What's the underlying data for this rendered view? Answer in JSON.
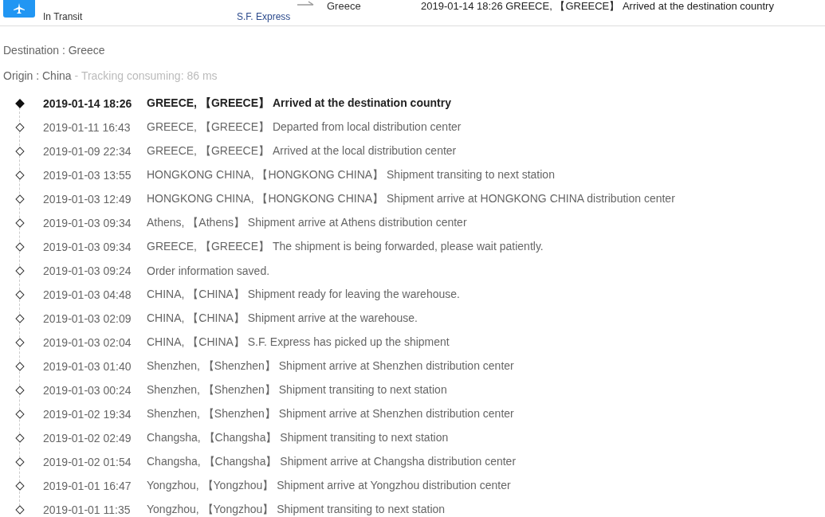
{
  "header": {
    "status": "In Transit",
    "carrier": "S.F. Express",
    "destination": "Greece",
    "latest_event": "2019-01-14 18:26  GREECE, 【GREECE】 Arrived at the destination country"
  },
  "destination": "Destination : Greece",
  "origin": "Origin : China",
  "tracking_time": "- Tracking consuming: 86 ms",
  "events": [
    {
      "time": "2019-01-14 18:26",
      "text": "GREECE, 【GREECE】 Arrived at the destination country",
      "current": true
    },
    {
      "time": "2019-01-11 16:43",
      "text": "GREECE, 【GREECE】 Departed from local distribution center",
      "current": false
    },
    {
      "time": "2019-01-09 22:34",
      "text": "GREECE, 【GREECE】 Arrived at the local distribution center",
      "current": false
    },
    {
      "time": "2019-01-03 13:55",
      "text": "HONGKONG CHINA, 【HONGKONG CHINA】 Shipment transiting to next station",
      "current": false
    },
    {
      "time": "2019-01-03 12:49",
      "text": "HONGKONG CHINA, 【HONGKONG CHINA】 Shipment arrive at HONGKONG CHINA distribution center",
      "current": false
    },
    {
      "time": "2019-01-03 09:34",
      "text": "Athens, 【Athens】 Shipment arrive at Athens distribution center",
      "current": false
    },
    {
      "time": "2019-01-03 09:34",
      "text": "GREECE, 【GREECE】 The shipment is being forwarded, please wait patiently.",
      "current": false
    },
    {
      "time": "2019-01-03 09:24",
      "text": "Order information saved.",
      "current": false
    },
    {
      "time": "2019-01-03 04:48",
      "text": "CHINA, 【CHINA】 Shipment ready for leaving the warehouse.",
      "current": false
    },
    {
      "time": "2019-01-03 02:09",
      "text": "CHINA, 【CHINA】 Shipment arrive at the warehouse.",
      "current": false
    },
    {
      "time": "2019-01-03 02:04",
      "text": "CHINA, 【CHINA】 S.F. Express has picked up the shipment",
      "current": false
    },
    {
      "time": "2019-01-03 01:40",
      "text": "Shenzhen, 【Shenzhen】 Shipment arrive at Shenzhen distribution center",
      "current": false
    },
    {
      "time": "2019-01-03 00:24",
      "text": "Shenzhen, 【Shenzhen】 Shipment transiting to next station",
      "current": false
    },
    {
      "time": "2019-01-02 19:34",
      "text": "Shenzhen, 【Shenzhen】 Shipment arrive at Shenzhen distribution center",
      "current": false
    },
    {
      "time": "2019-01-02 02:49",
      "text": "Changsha, 【Changsha】 Shipment transiting to next station",
      "current": false
    },
    {
      "time": "2019-01-02 01:54",
      "text": "Changsha, 【Changsha】 Shipment arrive at Changsha distribution center",
      "current": false
    },
    {
      "time": "2019-01-01 16:47",
      "text": "Yongzhou, 【Yongzhou】 Shipment arrive at Yongzhou distribution center",
      "current": false
    },
    {
      "time": "2019-01-01 11:35",
      "text": "Yongzhou, 【Yongzhou】 Shipment transiting to next station",
      "current": false
    }
  ]
}
